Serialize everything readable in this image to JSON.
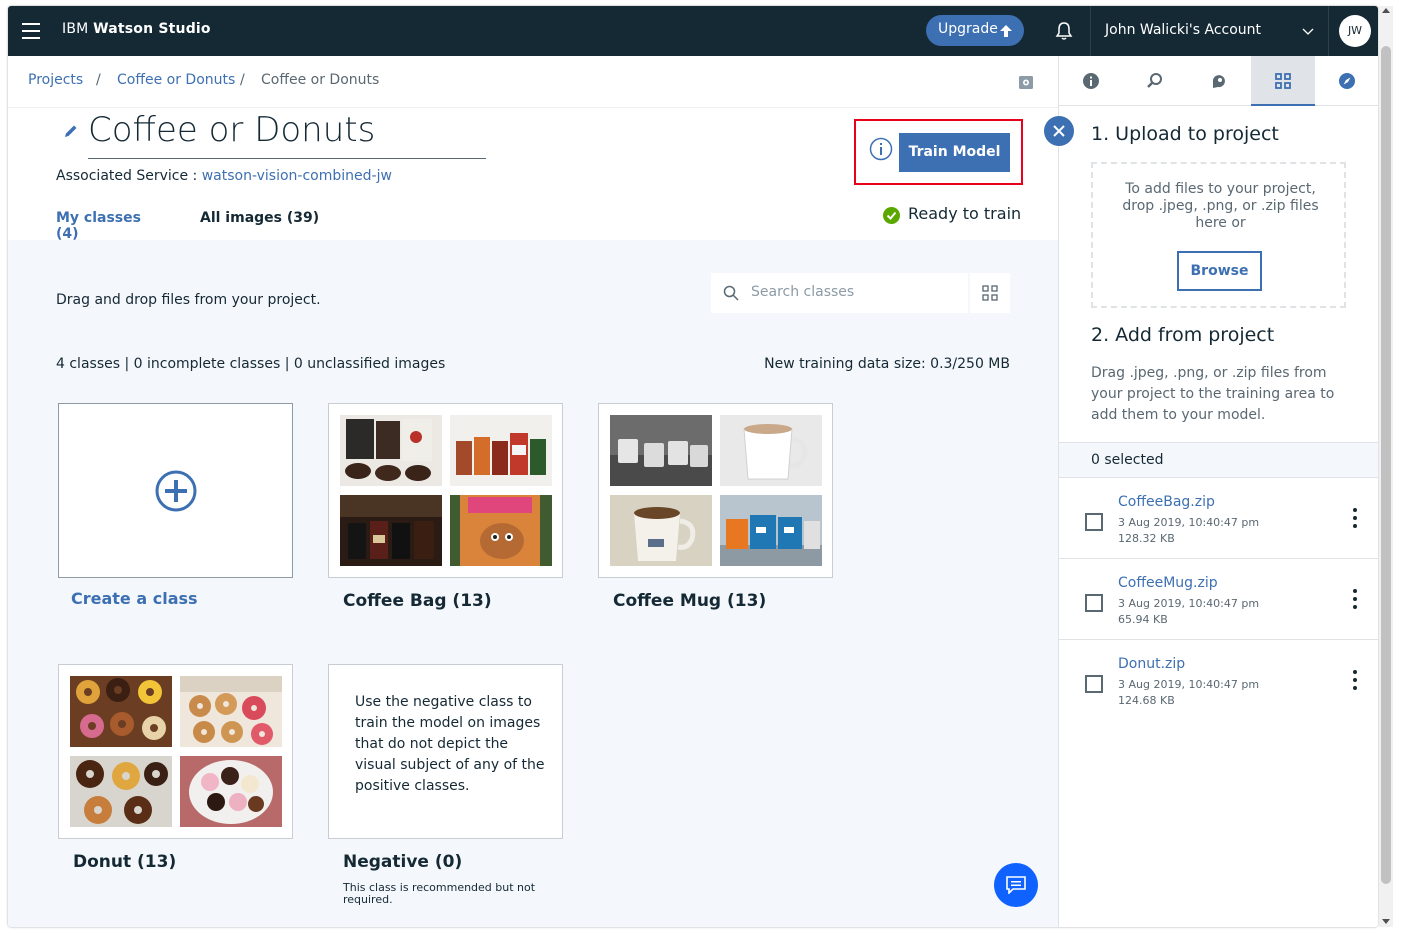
{
  "app": {
    "brand_prefix": "IBM",
    "brand_name": "Watson Studio"
  },
  "topbar": {
    "upgrade_label": "Upgrade",
    "account_name": "John Walicki's Account",
    "avatar_initials": "JW"
  },
  "breadcrumb": {
    "items": [
      "Projects",
      "Coffee or Donuts",
      "Coffee or Donuts"
    ],
    "separator": "/"
  },
  "header": {
    "title": "Coffee or Donuts",
    "assoc_label": "Associated Service :",
    "assoc_value": "watson-vision-combined-jw",
    "tabs": [
      {
        "label": "My classes (4)",
        "active": true
      },
      {
        "label": "All images (39)",
        "active": false
      }
    ],
    "train_label": "Train Model",
    "status": "Ready to train"
  },
  "main": {
    "drag_text": "Drag and drop files from your project.",
    "search_placeholder": "Search classes",
    "stats": "4 classes | 0 incomplete classes | 0 unclassified images",
    "size_label": "New training data size:",
    "size_value": "0.3/250 MB",
    "create_label": "Create a class",
    "classes": [
      {
        "label": "Coffee Bag (13)"
      },
      {
        "label": "Coffee Mug (13)"
      },
      {
        "label": "Donut (13)"
      },
      {
        "label": "Negative (0)"
      }
    ],
    "negative_text": "Use the negative class to train the model on images that do not depict the visual subject of any of the positive classes.",
    "negative_note": "This class is recommended but not required."
  },
  "panel": {
    "section1_title": "1. Upload to project",
    "drop_text": "To add files to your project, drop .jpeg, .png, or .zip files here or",
    "browse_label": "Browse",
    "section2_title": "2. Add from project",
    "section2_desc": "Drag .jpeg, .png, or .zip files from your project to the training area to add them to your model.",
    "selected": "0 selected",
    "files": [
      {
        "name": "CoffeeBag.zip",
        "date": "3 Aug 2019, 10:40:47 pm",
        "size": "128.32 KB"
      },
      {
        "name": "CoffeeMug.zip",
        "date": "3 Aug 2019, 10:40:47 pm",
        "size": "65.94 KB"
      },
      {
        "name": "Donut.zip",
        "date": "3 Aug 2019, 10:40:47 pm",
        "size": "124.68 KB"
      }
    ]
  },
  "colors": {
    "topbar": "#152935",
    "accent": "#3d70b2",
    "highlight": "#e8001c",
    "success": "#5aa700",
    "chat": "#0f62fe"
  },
  "icons": [
    "menu-icon",
    "upload-arrow-icon",
    "bell-icon",
    "chevron-down-icon",
    "settings-icon",
    "info-icon",
    "insights-icon",
    "collaborate-icon",
    "assets-icon",
    "compass-icon",
    "pencil-icon",
    "check-circle-icon",
    "search-icon",
    "grid-view-icon",
    "add-circle-icon",
    "close-icon",
    "overflow-menu-icon",
    "chat-icon"
  ]
}
